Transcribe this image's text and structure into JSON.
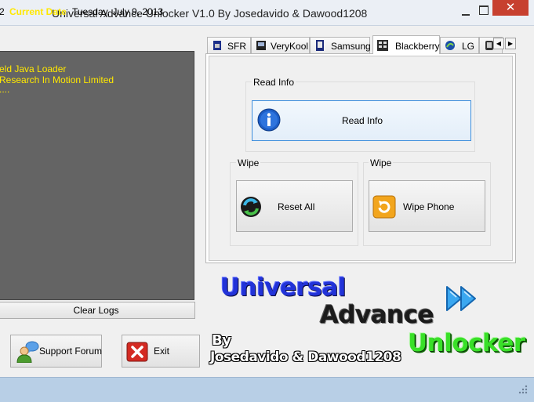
{
  "window": {
    "title": "Universal Advance Unlocker V1.0 By Josedavido & Dawood1208",
    "close_glyph": "✕"
  },
  "log_panel": {
    "lines": [
      "eld Java Loader",
      "Research In Motion Limited",
      "...."
    ]
  },
  "buttons": {
    "clear_logs": "Clear Logs",
    "support_forum": "Support Forum",
    "exit": "Exit"
  },
  "tabs": [
    {
      "label": "SFR",
      "icon": "sim-card-icon"
    },
    {
      "label": "VeryKool",
      "icon": "phone-icon"
    },
    {
      "label": "Samsung",
      "icon": "samsung-phone-icon"
    },
    {
      "label": "Blackberry",
      "icon": "blackberry-icon",
      "active": true
    },
    {
      "label": "LG",
      "icon": "lg-globe-icon"
    }
  ],
  "tab_scroll": {
    "left": "◀",
    "right": "▶"
  },
  "blackberry_page": {
    "read_info_group": "Read Info",
    "read_info_button": "Read Info",
    "wipe_group_left": "Wipe",
    "wipe_group_right": "Wipe",
    "reset_all_button": "Reset All",
    "wipe_phone_button": "Wipe Phone"
  },
  "banner": {
    "word1": "Universal",
    "word2": "Advance",
    "word3": "Unlocker",
    "by": "By",
    "authors": "Josedavido & Dawood1208"
  },
  "status_bar": {
    "prefix": "2",
    "label": "Current Date",
    "value": "Tuesday, July 9, 2013"
  },
  "colors": {
    "log_text": "#ffe800",
    "status_label": "#ffe800",
    "status_bar_bg": "#b8cfe6",
    "close_button": "#c7402f",
    "banner_blue": "#2233d8",
    "banner_green": "#39e028"
  }
}
